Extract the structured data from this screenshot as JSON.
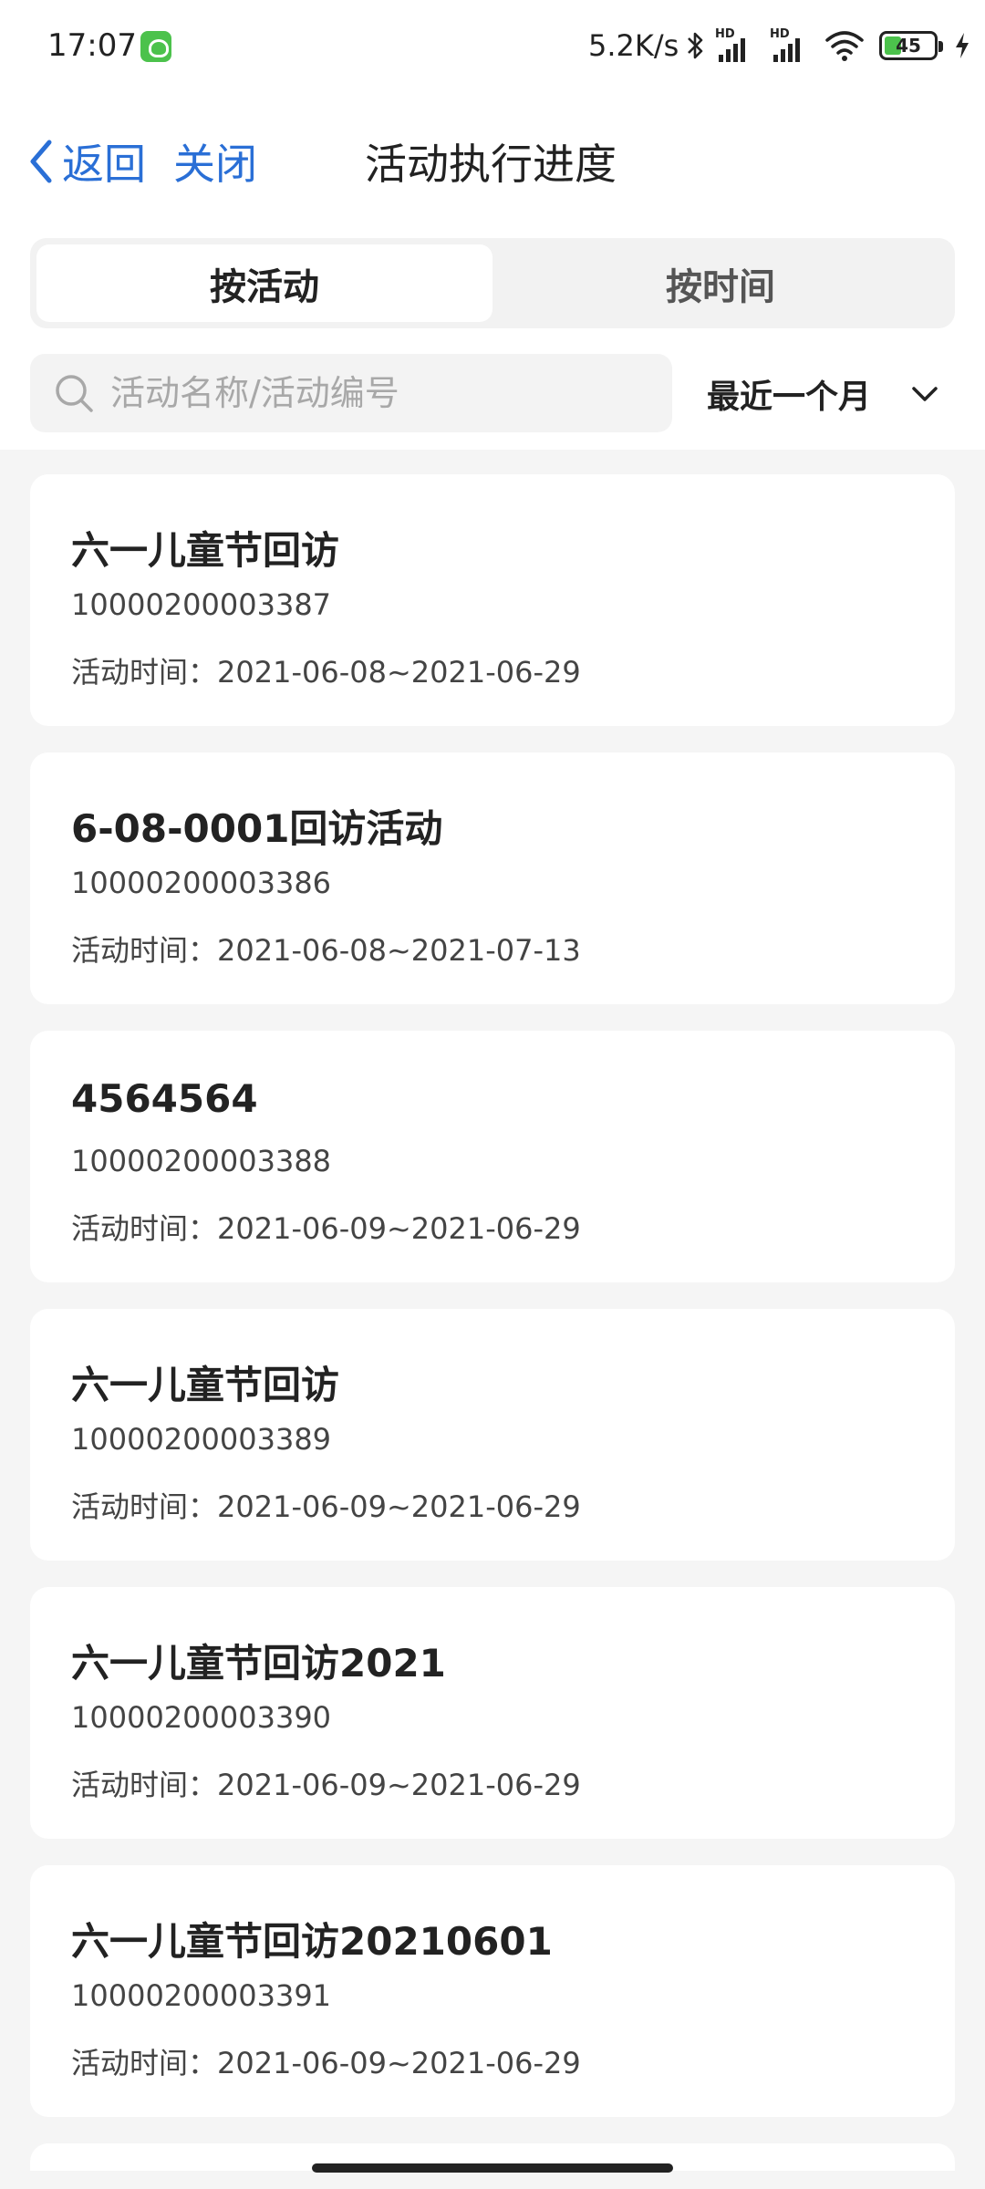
{
  "status_bar": {
    "time": "17:07",
    "net_speed": "5.2K/s",
    "sig1_label": "HD",
    "sig2_label": "HD",
    "battery": "45",
    "icons": [
      "app-notification-icon",
      "bluetooth-icon",
      "signal-icon",
      "wifi-icon",
      "battery-icon",
      "charging-icon"
    ]
  },
  "nav": {
    "back_label": "返回",
    "close_label": "关闭",
    "title": "活动执行进度"
  },
  "tabs": [
    {
      "label": "按活动",
      "active": true
    },
    {
      "label": "按时间",
      "active": false
    }
  ],
  "search": {
    "placeholder": "活动名称/活动编号",
    "value": ""
  },
  "filter": {
    "selected": "最近一个月"
  },
  "activities": [
    {
      "name": "六一儿童节回访",
      "number": "10000200003387",
      "time": "活动时间：2021-06-08~2021-06-29"
    },
    {
      "name": "6-08-0001回访活动",
      "number": "10000200003386",
      "time": "活动时间：2021-06-08~2021-07-13"
    },
    {
      "name": "4564564",
      "number": "10000200003388",
      "time": "活动时间：2021-06-09~2021-06-29"
    },
    {
      "name": "六一儿童节回访",
      "number": "10000200003389",
      "time": "活动时间：2021-06-09~2021-06-29"
    },
    {
      "name": "六一儿童节回访2021",
      "number": "10000200003390",
      "time": "活动时间：2021-06-09~2021-06-29"
    },
    {
      "name": "六一儿童节回访20210601",
      "number": "10000200003391",
      "time": "活动时间：2021-06-09~2021-06-29"
    }
  ],
  "colors": {
    "accent": "#2a6fd6",
    "background": "#f5f5f5",
    "card": "#ffffff"
  }
}
